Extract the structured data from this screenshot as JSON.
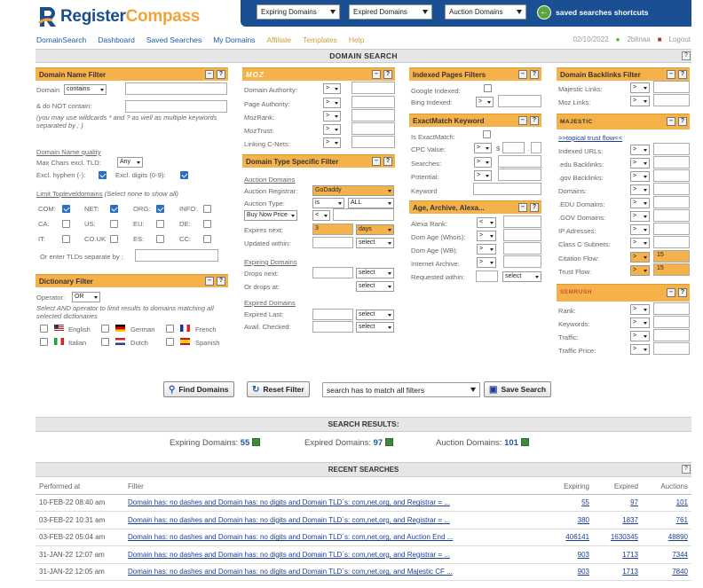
{
  "brand": {
    "name_part1": "Register",
    "name_part2": "Compass"
  },
  "topbar": {
    "dropdown1": "Expiring Domains",
    "dropdown2": "Expired Domains",
    "dropdown3": "Auction Domains",
    "shortcuts": "saved searches shortcuts"
  },
  "nav": [
    "DomainSearch",
    "Dashboard",
    "Saved Searches",
    "My Domains",
    "Affiliate",
    "Templates",
    "Help"
  ],
  "userbar": {
    "date": "02/10/2022",
    "user": "2bitnaa",
    "logout": "Logout"
  },
  "section_title": "DOMAIN SEARCH",
  "domain_name_filter": {
    "title": "Domain Name Filter",
    "domain_label": "Domain",
    "domain_op": "contains",
    "not_contain_label": "& do NOT contain:",
    "hint": "(you may use wildcards * and ? as well as multiple keywords separated by ; )",
    "quality_label": "Domain Name quality",
    "max_chars_label": "Max Chars excl. TLD:",
    "max_chars_value": "Any",
    "excl_hyphen_label": "Excl. hyphen (-):",
    "excl_digits_label": "Excl. digits (0-9):",
    "tld_label": "Limit Topleveldomains",
    "tld_hint": "(Select none to show all)",
    "tlds": [
      "COM:",
      "NET:",
      "ORG:",
      "INFO:",
      "CA:",
      "US:",
      "EU:",
      "DE:",
      "IT:",
      "CO.UK",
      "ES:",
      "CC:"
    ],
    "tld_other_label": "Or enter TLDs separate by ;"
  },
  "dictionary_filter": {
    "title": "Dictionary Filter",
    "operator_label": "Operator:",
    "operator_value": "OR",
    "hint": "Select AND operator to limit results to domains matching all selected dictionaries",
    "languages": [
      "English",
      "German",
      "French",
      "Italian",
      "Dutch",
      "Spanish"
    ]
  },
  "moz": {
    "title": "MOZ",
    "rows": [
      "Domain Authority:",
      "Page Authority:",
      "MozRank:",
      "MozTrust:",
      "Linking C-Nets:"
    ],
    "op": ">"
  },
  "domain_type_filter": {
    "title": "Domain Type Specific Filter",
    "auction_heading": "Auction Domains",
    "registrar_label": "Auction Registrar:",
    "registrar_value": "GoDaddy",
    "type_label": "Auction Type:",
    "type_op": "is",
    "type_value": "ALL",
    "buy_now_label": "Buy Now Price",
    "buy_now_op": "<",
    "expires_label": "Expires next:",
    "expires_value": "3",
    "expires_unit": "days",
    "updated_label": "Updated within:",
    "select": "select",
    "expiring_heading": "Expiring Domains",
    "drops_label": "Drops next:",
    "or_drops_label": "Or drops at:",
    "expired_heading": "Expired Domains",
    "expired_last_label": "Expired Last:",
    "avail_checked_label": "Avail. Checked:"
  },
  "indexed_pages": {
    "title": "Indexed Pages Filters",
    "google_label": "Google Indexed:",
    "bing_label": "Bing Indexed:"
  },
  "exactmatch": {
    "title": "ExactMatch Keyword",
    "is_label": "Is ExactMatch:",
    "cpc_label": "CPC Value:",
    "searches_label": "Searches:",
    "potential_label": "Potential:",
    "keyword_label": "Keyword",
    "currency": "$"
  },
  "age_archive": {
    "title": "Age, Archive, Alexa...",
    "rows": [
      "Alexa Rank:",
      "Dom Age (Whois):",
      "Dom Age (WB):",
      "Internet Archive:",
      "Requested within:"
    ]
  },
  "backlinks": {
    "title": "Domain Backlinks Filter",
    "rows": [
      "Majestic Links:",
      "Moz Links:"
    ]
  },
  "majestic": {
    "logo": "MAJESTIC",
    "topical_link": ">>topical trust flow<<",
    "rows": [
      "Indexed URLs:",
      ".edu Backlinks:",
      ".gov Backlinks:",
      "Domains:",
      ".EDU Domains:",
      ".GOV Domains:",
      "IP Adresses:",
      "Class C Subnets:",
      "Citation Flow:",
      "Trust Flow:"
    ],
    "citation_value": "15",
    "trust_value": "15"
  },
  "semrush": {
    "logo": "SEMRUSH",
    "rows": [
      "Rank:",
      "Keywords:",
      "Traffic:",
      "Traffic Price:"
    ]
  },
  "actions": {
    "find": "Find Domains",
    "reset": "Reset Filter",
    "match_mode": "search has to match all filters",
    "save": "Save Search"
  },
  "results": {
    "title": "SEARCH RESULTS:",
    "expiring_label": "Expiring Domains:",
    "expiring_count": "55",
    "expired_label": "Expired Domains:",
    "expired_count": "97",
    "auction_label": "Auction Domains:",
    "auction_count": "101"
  },
  "recent": {
    "title": "RECENT SEARCHES",
    "headers": [
      "Performed at",
      "Filter",
      "Expiring",
      "Expired",
      "Auctions"
    ],
    "rows": [
      [
        "10-FEB-22 08:40 am",
        "Domain has: no dashes and Domain has: no digits and Domain TLD´s: com,net,org, and Registrar = ...",
        "55",
        "97",
        "101"
      ],
      [
        "03-FEB-22 10:31 am",
        "Domain has: no dashes and Domain has: no digits and Domain TLD´s: com,net,org, and Registrar = ...",
        "380",
        "1837",
        "761"
      ],
      [
        "03-FEB-22 05:04 am",
        "Domain has: no dashes and Domain has: no digits and Domain TLD´s: com,net,org, and Auction End ...",
        "406141",
        "1630345",
        "48890"
      ],
      [
        "31-JAN-22 12:07 am",
        "Domain has: no dashes and Domain has: no digits and Domain TLD´s: com,net,org, and Registrar = ...",
        "903",
        "1713",
        "7344"
      ],
      [
        "31-JAN-22 12:05 am",
        "Domain has: no dashes and Domain has: no digits and Domain TLD´s: com,net,org, and Majestic CF ...",
        "903",
        "1713",
        "7840"
      ]
    ]
  },
  "colors": {
    "brand_blue": "#1b4f93",
    "accent_orange": "#f6b24a",
    "link_blue": "#1d5ba3"
  }
}
